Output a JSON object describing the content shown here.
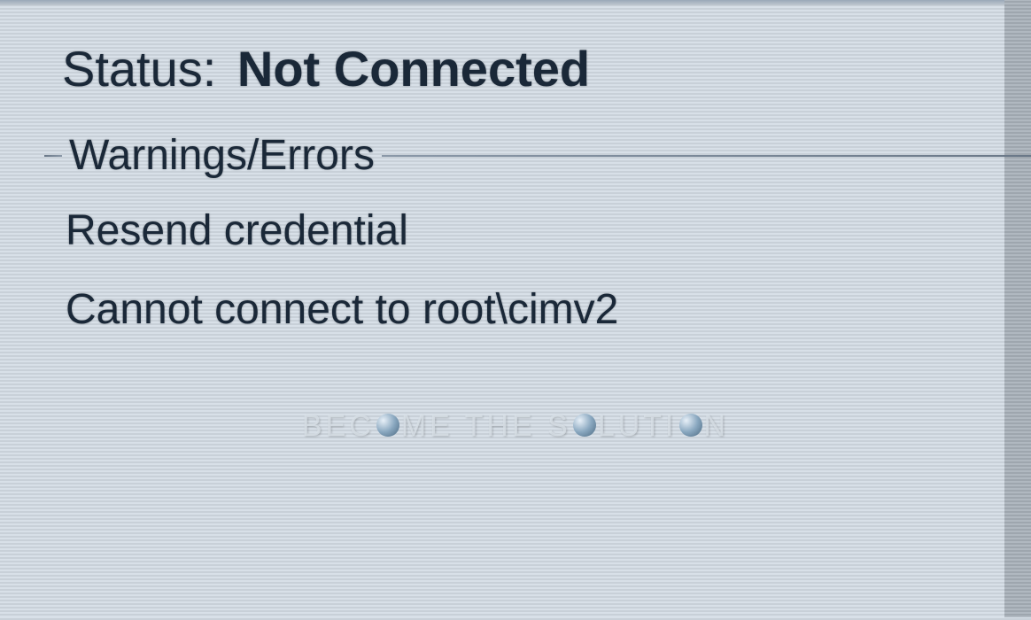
{
  "status": {
    "label": "Status:",
    "value": "Not Connected"
  },
  "errors_section": {
    "title": "Warnings/Errors",
    "messages": [
      "Resend credential",
      "Cannot connect to root\\cimv2"
    ]
  },
  "watermark": {
    "text_parts": [
      "BEC",
      "ME THE S",
      "LUTI",
      "N"
    ]
  }
}
